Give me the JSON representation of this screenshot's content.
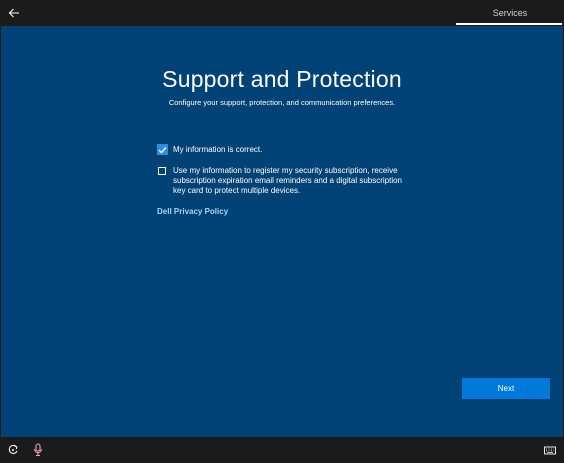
{
  "topbar": {
    "back_icon": "arrow-left-icon",
    "tab_label": "Services"
  },
  "main": {
    "title": "Support and Protection",
    "subtitle": "Configure your support, protection, and communication preferences.",
    "options": [
      {
        "label": "My information is correct.",
        "checked": true
      },
      {
        "label": "Use my information to register my security subscription, receive subscription expiration email reminders and a digital subscription key card to protect multiple devices.",
        "checked": false
      }
    ],
    "privacy_link": "Dell Privacy Policy",
    "next_label": "Next"
  },
  "bottombar": {
    "icons": [
      "ease-of-access-icon",
      "microphone-icon",
      "keyboard-icon"
    ]
  },
  "colors": {
    "panel_bg": "#004275",
    "accent": "#0078d7",
    "checkbox_checked": "#2f8fde",
    "link": "#a8d4ff",
    "chrome_bg": "#1b1b1b"
  }
}
